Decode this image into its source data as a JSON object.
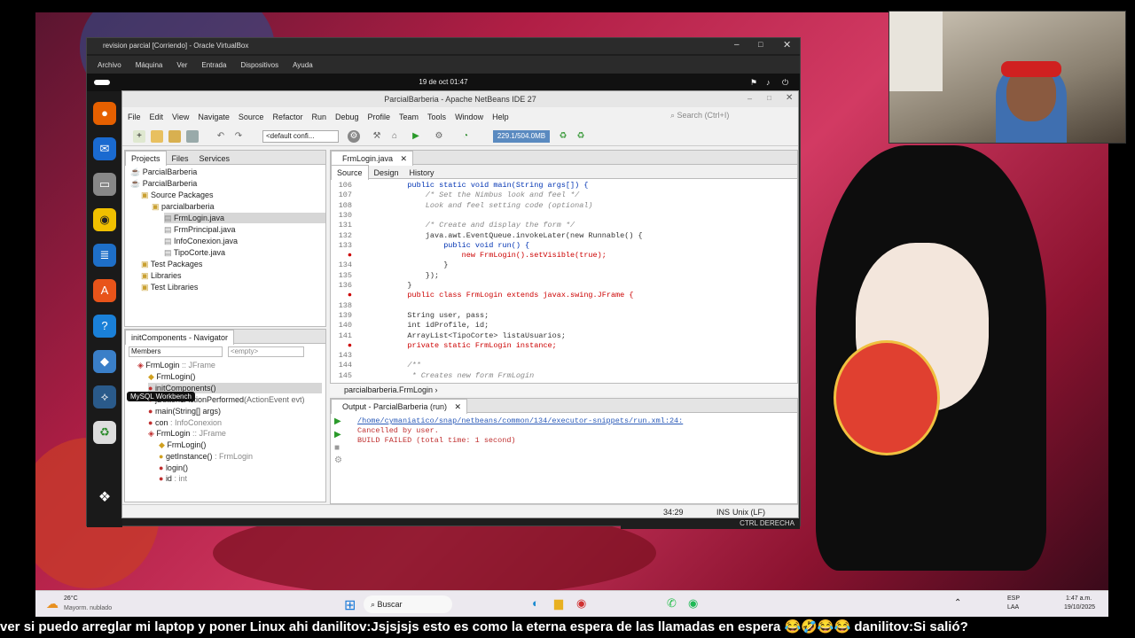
{
  "virtualbox": {
    "title": "revision parcial [Corriendo] - Oracle VirtualBox",
    "menu": [
      "Archivo",
      "Máquina",
      "Ver",
      "Entrada",
      "Dispositivos",
      "Ayuda"
    ]
  },
  "gnome": {
    "clock": "19 de oct  01:47"
  },
  "tooltip": "MySQL Workbench",
  "netbeans": {
    "title": "ParcialBarberia - Apache NetBeans IDE 27",
    "menu": [
      "File",
      "Edit",
      "View",
      "Navigate",
      "Source",
      "Refactor",
      "Run",
      "Debug",
      "Profile",
      "Team",
      "Tools",
      "Window",
      "Help"
    ],
    "search_placeholder": "Search (Ctrl+I)",
    "config": "<default confi...",
    "memory": "229.1/504.0MB",
    "project_tabs": [
      "Projects",
      "Files",
      "Services"
    ],
    "tree": [
      "ParcialBarberia",
      "ParcialBarberia",
      "Source Packages",
      "parcialbarberia",
      "FrmLogin.java",
      "FrmPrincipal.java",
      "InfoConexion.java",
      "TipoCorte.java",
      "Test Packages",
      "Libraries",
      "Test Libraries"
    ],
    "navigator": {
      "title": "initComponents - Navigator",
      "members": "Members",
      "empty": "<empty>",
      "items": [
        {
          "name": "FrmLogin",
          "type": " :: JFrame"
        },
        {
          "name": "FrmLogin()",
          "type": ""
        },
        {
          "name": "initComponents()",
          "type": ""
        },
        {
          "name": "jButton1ActionPerformed",
          "type": "(ActionEvent evt)"
        },
        {
          "name": "main(String[] args)",
          "type": ""
        },
        {
          "name": "con",
          "type": " : InfoConexion"
        },
        {
          "name": "FrmLogin",
          "type": " :: JFrame"
        },
        {
          "name": "FrmLogin()",
          "type": ""
        },
        {
          "name": "getInstance()",
          "type": " : FrmLogin"
        },
        {
          "name": "login()",
          "type": ""
        },
        {
          "name": "id",
          "type": " : int"
        }
      ]
    },
    "editor": {
      "tab": "FrmLogin.java",
      "subtabs": [
        "Source",
        "Design",
        "History"
      ],
      "breadcrumb": "parcialbarberia.FrmLogin",
      "lines": [
        {
          "n": "106",
          "t": "    public static void main(String args[]) {"
        },
        {
          "n": "107",
          "t": "        /* Set the Nimbus look and feel */"
        },
        {
          "n": "108",
          "t": "        Look and feel setting code (optional)"
        },
        {
          "n": "130",
          "t": ""
        },
        {
          "n": "131",
          "t": "        /* Create and display the form */"
        },
        {
          "n": "132",
          "t": "        java.awt.EventQueue.invokeLater(new Runnable() {"
        },
        {
          "n": "133",
          "t": "            public void run() {"
        },
        {
          "n": "",
          "t": "                new FrmLogin().setVisible(true);"
        },
        {
          "n": "134",
          "t": "            }"
        },
        {
          "n": "135",
          "t": "        });"
        },
        {
          "n": "136",
          "t": "    }"
        },
        {
          "n": "",
          "t": "    public class FrmLogin extends javax.swing.JFrame {"
        },
        {
          "n": "138",
          "t": ""
        },
        {
          "n": "139",
          "t": "    String user, pass;"
        },
        {
          "n": "140",
          "t": "    int idProfile, id;"
        },
        {
          "n": "141",
          "t": "    ArrayList<TipoCorte> listaUsuarios;"
        },
        {
          "n": "",
          "t": "    private static FrmLogin instance;"
        },
        {
          "n": "143",
          "t": ""
        },
        {
          "n": "144",
          "t": "    /**"
        },
        {
          "n": "145",
          "t": "     * Creates new form FrmLogin"
        }
      ]
    },
    "output": {
      "title": "Output - ParcialBarberia (run)",
      "lines": [
        "/home/cymaniatico/snap/netbeans/common/134/executor-snippets/run.xml:24:",
        "Cancelled by user.",
        "BUILD FAILED (total time: 1 second)"
      ]
    },
    "status": {
      "pos": "34:29",
      "mode": "INS",
      "eol": "Unix (LF)"
    }
  },
  "vbox_status": "CTRL DERECHA",
  "taskbar": {
    "temp": "26°C",
    "weather": "Mayorm. nublado",
    "search": "Buscar",
    "lang1": "ESP",
    "lang2": "LAA",
    "time": "1:47 a.m.",
    "date": "19/10/2025"
  },
  "ticker": "ver si puedo arreglar mi laptop y poner Linux ahi danilitov:Jsjsjsjs esto es como la eterna espera de las llamadas en espera 😂🤣😂😂 danilitov:Si salió?"
}
